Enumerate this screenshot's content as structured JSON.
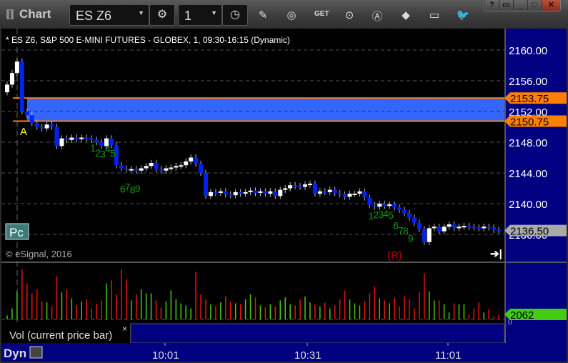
{
  "window": {
    "title": "Chart",
    "symbol": "ES Z6",
    "interval": "1",
    "controls": [
      "?",
      "▭",
      "_",
      "□",
      "✕"
    ]
  },
  "toolbar_icons": [
    "pencil-icon",
    "chart-settings-icon",
    "get-data-icon",
    "play-icon",
    "auto-icon",
    "link-icon",
    "comment-icon",
    "twitter-icon"
  ],
  "chart": {
    "header": "* ES Z6, S&P 500 E-MINI FUTURES - GLOBEX, 1, 09:30-16:15 (Dynamic)",
    "copyright": "© eSignal, 2016",
    "pc_label": "Pc",
    "marker_a": "A",
    "marker_r": "(R)",
    "price_ticks": [
      "2160.00",
      "2156.00",
      "2152.00",
      "2148.00",
      "2144.00",
      "2140.00",
      "2136.00"
    ],
    "tick_values": [
      2160,
      2156,
      2152,
      2148,
      2144,
      2140,
      2136
    ],
    "zone": {
      "high": 2153.75,
      "low": 2150.75,
      "high_label": "2153.75",
      "low_label": "2150.75",
      "color": "#3366ff",
      "edge_color": "#ff8000"
    },
    "last_price": "2136.50",
    "last_price_value": 2136.5,
    "annotations": [
      {
        "text": "1",
        "bar": 17
      },
      {
        "text": "2",
        "bar": 18
      },
      {
        "text": "3",
        "bar": 19
      },
      {
        "text": "4",
        "bar": 20
      },
      {
        "text": "5",
        "bar": 21
      },
      {
        "text": "6",
        "bar": 23
      },
      {
        "text": "7",
        "bar": 24
      },
      {
        "text": "8",
        "bar": 25
      },
      {
        "text": "9",
        "bar": 26
      },
      {
        "text": "1",
        "bar": 73
      },
      {
        "text": "2",
        "bar": 74
      },
      {
        "text": "3",
        "bar": 75
      },
      {
        "text": "4",
        "bar": 76
      },
      {
        "text": "5",
        "bar": 77
      },
      {
        "text": "6",
        "bar": 78
      },
      {
        "text": "7",
        "bar": 79
      },
      {
        "text": "8",
        "bar": 80
      },
      {
        "text": "9",
        "bar": 81
      }
    ],
    "closes": [
      2155.5,
      2157,
      2158.5,
      2152,
      2151.5,
      2150.5,
      2150,
      2149.8,
      2150.3,
      2150,
      2147.5,
      2148.5,
      2148.3,
      2148.6,
      2148.4,
      2148.6,
      2148.5,
      2148.3,
      2148,
      2147.5,
      2148.5,
      2147.6,
      2145,
      2144.6,
      2144.5,
      2144.5,
      2144.3,
      2144.6,
      2144.9,
      2145.3,
      2144.5,
      2144.3,
      2144.6,
      2144.7,
      2144.9,
      2145,
      2145.5,
      2146,
      2145.2,
      2144,
      2141,
      2141.5,
      2141.4,
      2141.6,
      2141.2,
      2141.1,
      2141.5,
      2141.3,
      2141.5,
      2141.7,
      2141.4,
      2141.6,
      2141.3,
      2141.6,
      2141,
      2141.8,
      2142,
      2142.4,
      2142.3,
      2142.2,
      2142.5,
      2142.6,
      2141.3,
      2141.6,
      2141.5,
      2141.8,
      2141.4,
      2141.2,
      2140.9,
      2141.3,
      2141.3,
      2141.6,
      2140.8,
      2139.8,
      2139.6,
      2140,
      2139.7,
      2139.9,
      2139.5,
      2139.2,
      2138.8,
      2138.2,
      2137.5,
      2136.7,
      2135,
      2136.8,
      2137,
      2136.4,
      2137,
      2137.3,
      2136.8,
      2137,
      2137.1,
      2137,
      2136.9,
      2136.8,
      2137,
      2136.9,
      2136.6,
      2136.5
    ],
    "up_color": "#ffffff",
    "down_color": "#0022ee"
  },
  "volume": {
    "label": "Vol (current price bar)",
    "close_label": "×",
    "last": "2062",
    "zero": "0",
    "values": [
      8,
      22,
      56,
      100,
      72,
      52,
      60,
      36,
      34,
      26,
      86,
      54,
      60,
      42,
      28,
      36,
      40,
      22,
      30,
      38,
      72,
      78,
      50,
      100,
      80,
      38,
      50,
      60,
      52,
      52,
      38,
      24,
      36,
      58,
      40,
      32,
      28,
      22,
      95,
      50,
      40,
      30,
      26,
      34,
      46,
      36,
      32,
      30,
      40,
      50,
      44,
      28,
      24,
      30,
      26,
      38,
      44,
      30,
      28,
      40,
      46,
      34,
      30,
      26,
      34,
      22,
      28,
      40,
      58,
      40,
      32,
      28,
      36,
      52,
      66,
      42,
      38,
      32,
      44,
      26,
      46,
      40,
      22,
      54,
      92,
      56,
      38,
      38,
      30,
      14,
      32,
      30,
      30,
      10,
      22,
      34,
      14,
      20,
      6,
      10
    ],
    "up_color": "#44cc11",
    "down_color": "#ee1111"
  },
  "time_axis": {
    "labels": [
      "10:01",
      "10:31",
      "11:01"
    ],
    "dyn": "Dyn"
  }
}
